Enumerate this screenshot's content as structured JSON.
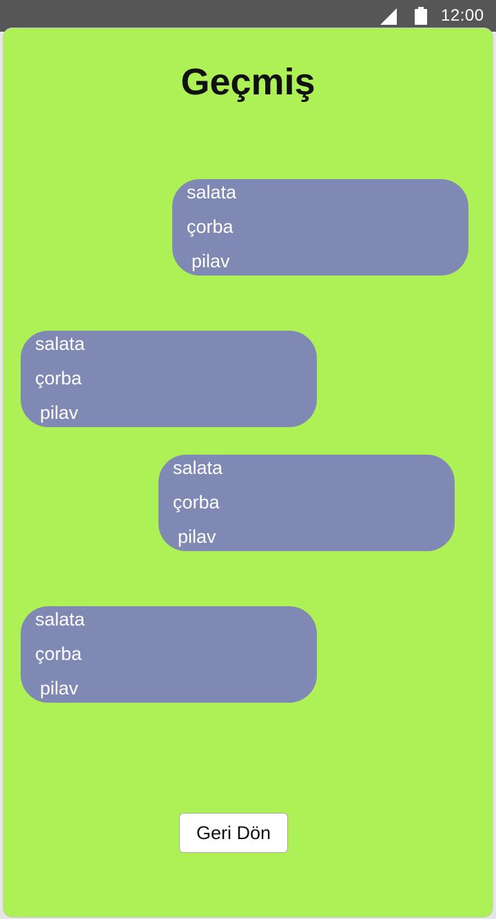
{
  "status_bar": {
    "time": "12:00",
    "icons": [
      "cellular-signal-icon",
      "battery-icon"
    ]
  },
  "colors": {
    "status_bar": "#565656",
    "background": "#adf157",
    "bubble": "#7f89b3",
    "bubble_text": "#ffffff",
    "title_text": "#111111"
  },
  "page": {
    "title": "Geçmiş"
  },
  "history": [
    {
      "items": [
        "salata",
        "çorba",
        "pilav"
      ]
    },
    {
      "items": [
        "salata",
        "çorba",
        "pilav"
      ]
    },
    {
      "items": [
        "salata",
        "çorba",
        "pilav"
      ]
    },
    {
      "items": [
        "salata",
        "çorba",
        "pilav"
      ]
    }
  ],
  "actions": {
    "back_label": "Geri Dön"
  }
}
